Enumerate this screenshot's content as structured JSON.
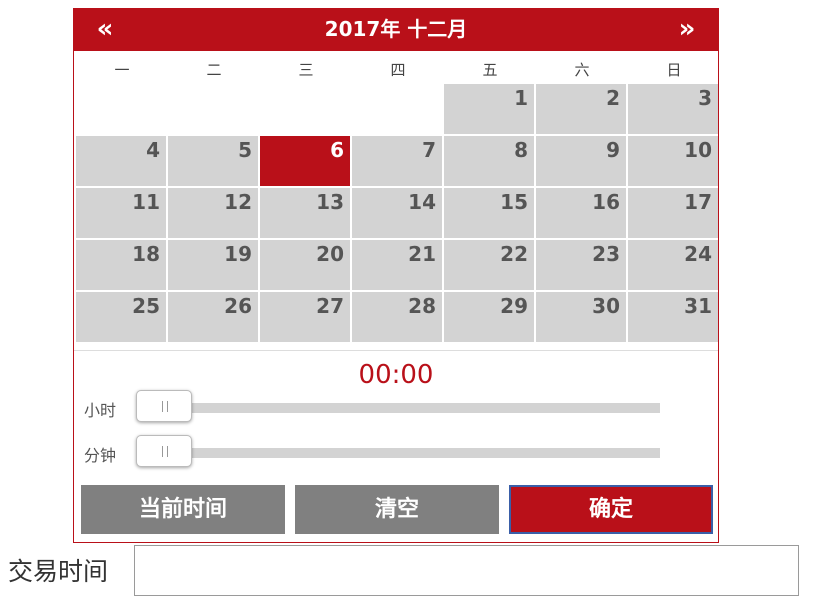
{
  "calendar": {
    "title": "2017年 十二月",
    "prev_icon": "«",
    "next_icon": "»",
    "weekdays": [
      "一",
      "二",
      "三",
      "四",
      "五",
      "六",
      "日"
    ],
    "days": [
      "1",
      "2",
      "3",
      "4",
      "5",
      "6",
      "7",
      "8",
      "9",
      "10",
      "11",
      "12",
      "13",
      "14",
      "15",
      "16",
      "17",
      "18",
      "19",
      "20",
      "21",
      "22",
      "23",
      "24",
      "25",
      "26",
      "27",
      "28",
      "29",
      "30",
      "31"
    ],
    "selected_day": "6"
  },
  "time": {
    "display": "00:00",
    "hour_label": "小时",
    "minute_label": "分钟",
    "hour_value": 0,
    "minute_value": 0
  },
  "buttons": {
    "now_label": "当前时间",
    "clear_label": "清空",
    "confirm_label": "确定"
  },
  "field": {
    "label": "交易时间",
    "value": ""
  },
  "colors": {
    "accent": "#b91019",
    "cell": "#d3d3d3",
    "button_gray": "#808080"
  }
}
